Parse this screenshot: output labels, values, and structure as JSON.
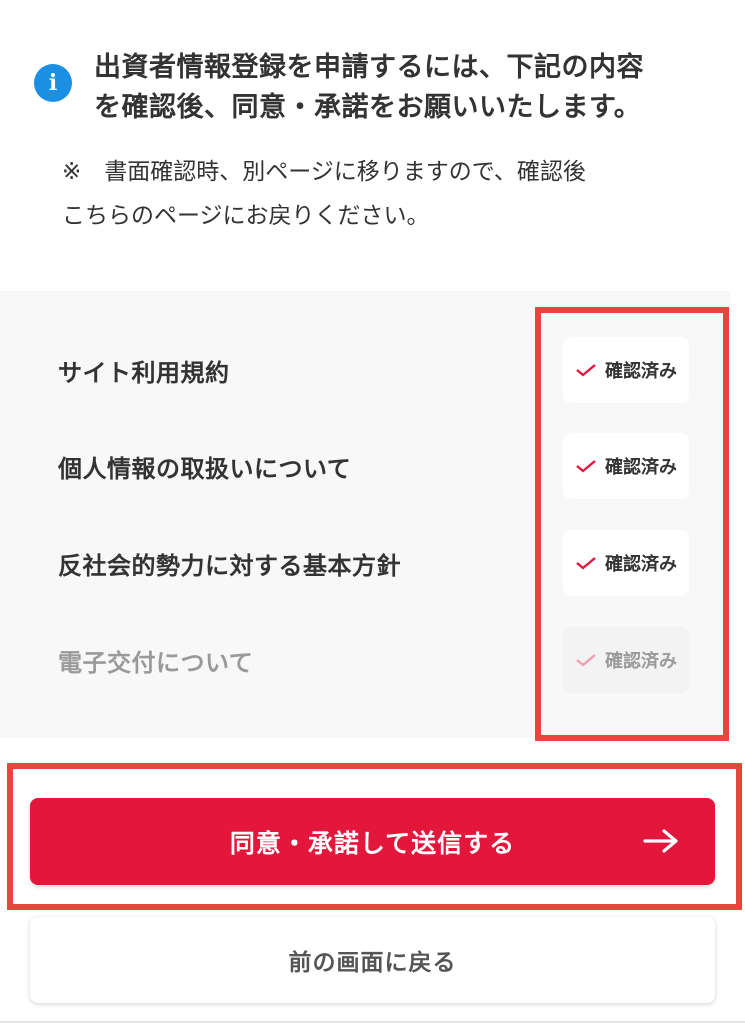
{
  "header": {
    "info_icon": "info-icon",
    "title_line1": "出資者情報登録を申請するには、下記の内容",
    "title_line2": "を確認後、同意・承諾をお願いいたします。"
  },
  "note": {
    "line1": "※　書面確認時、別ページに移りますので、確認後",
    "line2": "こちらのページにお戻りください。"
  },
  "documents": [
    {
      "label": "サイト利用規約",
      "status": "確認済み",
      "enabled": true
    },
    {
      "label": "個人情報の取扱いについて",
      "status": "確認済み",
      "enabled": true
    },
    {
      "label": "反社会的勢力に対する基本方針",
      "status": "確認済み",
      "enabled": true
    },
    {
      "label": "電子交付について",
      "status": "確認済み",
      "enabled": false
    }
  ],
  "actions": {
    "submit_label": "同意・承諾して送信する",
    "submit_icon": "arrow-right-icon",
    "back_label": "前の画面に戻る"
  },
  "colors": {
    "accent": "#e3163c",
    "info": "#1a8fe3",
    "highlight": "#e8463c"
  }
}
